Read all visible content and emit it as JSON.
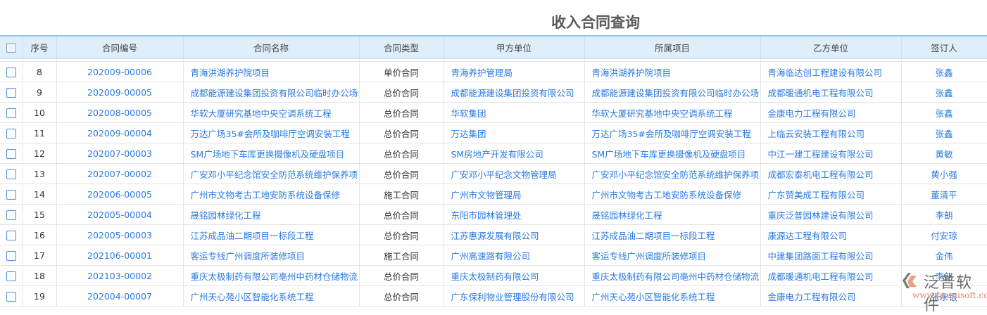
{
  "title": "收入合同查询",
  "columns": [
    "序号",
    "合同编号",
    "合同名称",
    "合同类型",
    "甲方单位",
    "所属项目",
    "乙方单位",
    "签订人"
  ],
  "rows": [
    {
      "no": "8",
      "code": "202009-00006",
      "name": "青海洪湖养护院项目",
      "type": "单价合同",
      "partyA": "青海养护管理局",
      "project": "青海洪湖养护院项目",
      "partyB": "青海临达创工程建设有限公司",
      "signer": "张鑫"
    },
    {
      "no": "9",
      "code": "202009-00005",
      "name": "成都能源建设集团投资有限公司临时办公场",
      "type": "总价合同",
      "partyA": "成都能源建设集团投资有限公司",
      "project": "成都能源建设集团投资有限公司临时办公场",
      "partyB": "成都暖通机电工程有限公司",
      "signer": "张鑫"
    },
    {
      "no": "10",
      "code": "202008-00005",
      "name": "华软大厦研究基地中央空调系统工程",
      "type": "总价合同",
      "partyA": "华软集团",
      "project": "华软大厦研究基地中央空调系统工程",
      "partyB": "金康电力工程有限公司",
      "signer": "张鑫"
    },
    {
      "no": "11",
      "code": "202009-00004",
      "name": "万达广场35#会所及咖啡厅空调安装工程",
      "type": "总价合同",
      "partyA": "万达集团",
      "project": "万达广场35#会所及咖啡厅空调安装工程",
      "partyB": "上临云安装工程有限公司",
      "signer": "张鑫"
    },
    {
      "no": "12",
      "code": "202007-00003",
      "name": "SM广场地下车库更换摄像机及硬盘项目",
      "type": "总价合同",
      "partyA": "SM房地产开发有限公司",
      "project": "SM广场地下车库更换摄像机及硬盘项目",
      "partyB": "中江一建工程建设有限公司",
      "signer": "黄敏"
    },
    {
      "no": "13",
      "code": "202007-00002",
      "name": "广安邓小平纪念馆安全防范系统维护保养项目",
      "type": "总价合同",
      "partyA": "广安邓小平纪念文物管理局",
      "project": "广安邓小平纪念馆安全防范系统维护保养项目",
      "partyB": "成都宏泰机电工程有限公司",
      "signer": "黄小强"
    },
    {
      "no": "14",
      "code": "202006-00005",
      "name": "广州市文物考古工地安防系统设备保修",
      "type": "施工合同",
      "partyA": "广州市文物管理局",
      "project": "广州市文物考古工地安防系统设备保修",
      "partyB": "广东赞美成工程有限公司",
      "signer": "董清平"
    },
    {
      "no": "15",
      "code": "202005-00004",
      "name": "晟铭园林绿化工程",
      "type": "总价合同",
      "partyA": "东阳市园林管理处",
      "project": "晟铭园林绿化工程",
      "partyB": "重庆泛普园林建设有限公司",
      "signer": "李朗"
    },
    {
      "no": "16",
      "code": "202005-00003",
      "name": "江苏成品油二期项目一标段工程",
      "type": "总价合同",
      "partyA": "江苏惠源发展有限公司",
      "project": "江苏成品油二期项目一标段工程",
      "partyB": "康源达工程有限公司",
      "signer": "付安琼"
    },
    {
      "no": "17",
      "code": "202106-00001",
      "name": "客运专线广州调度所装修项目",
      "type": "施工合同",
      "partyA": "广州高速路有限公司",
      "project": "客运专线广州调度所装修项目",
      "partyB": "中建集团路面工程有限公司",
      "signer": "金伟"
    },
    {
      "no": "18",
      "code": "202103-00002",
      "name": "重庆太极制药有限公司亳州中药材仓储物流",
      "type": "总价合同",
      "partyA": "重庆太极制药有限公司",
      "project": "重庆太极制药有限公司亳州中药材仓储物流",
      "partyB": "成都暖通机电工程有限公司",
      "signer": "李朗"
    },
    {
      "no": "19",
      "code": "202004-00007",
      "name": "广州天心苑小区智能化系统工程",
      "type": "总价合同",
      "partyA": "广东保利物业管理股份有限公司",
      "project": "广州天心苑小区智能化系统工程",
      "partyB": "金康电力工程有限公司",
      "signer": "张永银"
    }
  ],
  "watermark": {
    "name": "泛普软件",
    "url": "www.fanpusoft.com"
  },
  "colors": {
    "link": "#2a7ae2",
    "header_bg": "#dfeefb"
  }
}
